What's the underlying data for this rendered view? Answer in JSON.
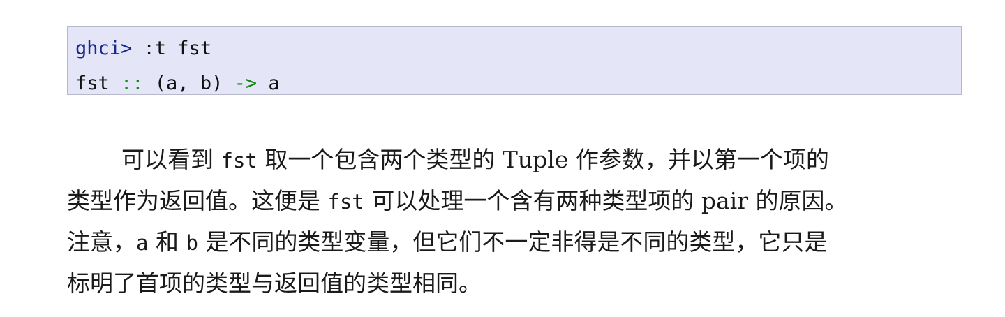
{
  "code_block": {
    "line1": {
      "prompt": "ghci>",
      "command": " :t fst"
    },
    "line2": {
      "name": "fst ",
      "double_colon": "::",
      "args": " (a, b) ",
      "arrow": "->",
      "result": " a"
    }
  },
  "paragraph": {
    "line1": {
      "t1": "可以看到 ",
      "c1": "fst",
      "t2": " 取一个包含两个类型的 Tuple 作参数，并以第一个项的"
    },
    "line2": {
      "t1": "类型作为返回值。这便是 ",
      "c1": "fst",
      "t2": " 可以处理一个含有两种类型项的 pair 的原因。"
    },
    "line3": {
      "t1": "注意，",
      "c1": "a",
      "t2": " 和 ",
      "c2": "b",
      "t3": " 是不同的类型变量，但它们不一定非得是不同的类型，它只是"
    },
    "line4": {
      "t1": "标明了首项的类型与返回值的类型相同。"
    }
  },
  "colors": {
    "code_background": "#e5e5f8",
    "prompt": "#1a2a8a",
    "operator": "#108a10"
  }
}
